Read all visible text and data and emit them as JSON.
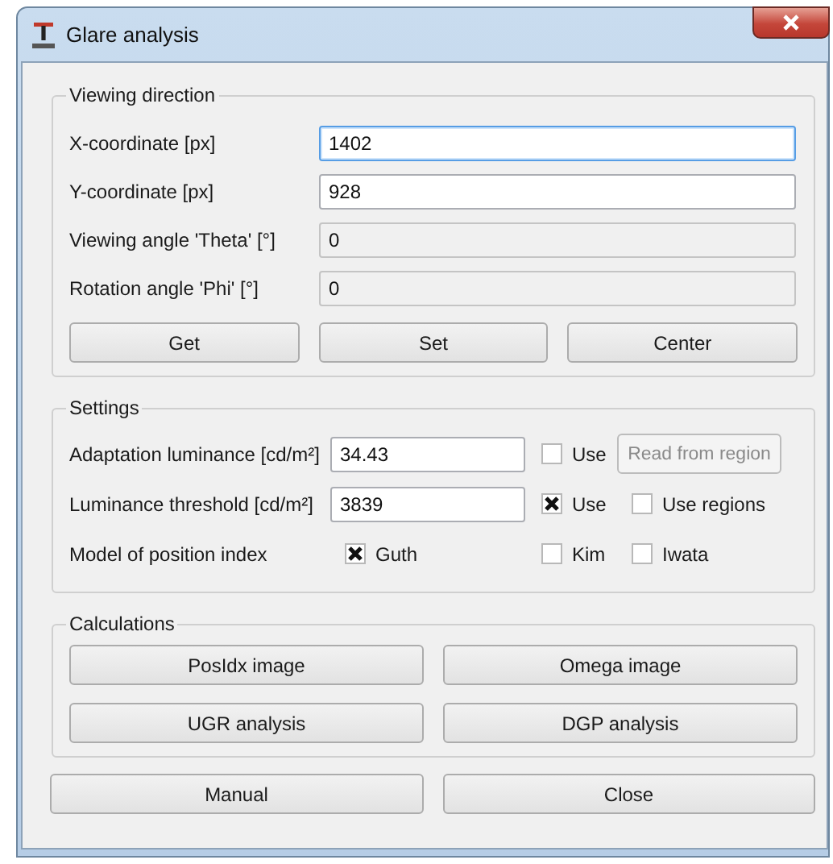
{
  "window": {
    "title": "Glare analysis"
  },
  "viewing_direction": {
    "title": "Viewing direction",
    "fields": [
      {
        "label": "X-coordinate [px]",
        "value": "1402",
        "disabled": false,
        "focused": true
      },
      {
        "label": "Y-coordinate [px]",
        "value": "928",
        "disabled": false,
        "focused": false
      },
      {
        "label": "Viewing angle 'Theta' [°]",
        "value": "0",
        "disabled": true,
        "focused": false
      },
      {
        "label": "Rotation angle 'Phi' [°]",
        "value": "0",
        "disabled": true,
        "focused": false
      }
    ],
    "buttons": [
      "Get",
      "Set",
      "Center"
    ]
  },
  "settings": {
    "title": "Settings",
    "rows": [
      {
        "label": "Adaptation luminance [cd/m²]",
        "items": [
          {
            "kind": "field",
            "value": "34.43"
          },
          {
            "kind": "checkbox",
            "label": "Use",
            "checked": false
          },
          {
            "kind": "button",
            "label": "Read from region",
            "disabled": true
          }
        ]
      },
      {
        "label": "Luminance threshold [cd/m²]",
        "items": [
          {
            "kind": "field",
            "value": "3839"
          },
          {
            "kind": "checkbox",
            "label": "Use",
            "checked": true
          },
          {
            "kind": "checkbox",
            "label": "Use regions",
            "checked": false
          }
        ]
      },
      {
        "label": "Model of position index",
        "items": [
          {
            "kind": "checkbox",
            "label": "Guth",
            "checked": true
          },
          {
            "kind": "checkbox",
            "label": "Kim",
            "checked": false
          },
          {
            "kind": "checkbox",
            "label": "Iwata",
            "checked": false
          }
        ]
      }
    ]
  },
  "calculations": {
    "title": "Calculations",
    "buttons": [
      "PosIdx image",
      "Omega image",
      "UGR analysis",
      "DGP analysis"
    ]
  },
  "buttons": [
    "Manual",
    "Close"
  ]
}
